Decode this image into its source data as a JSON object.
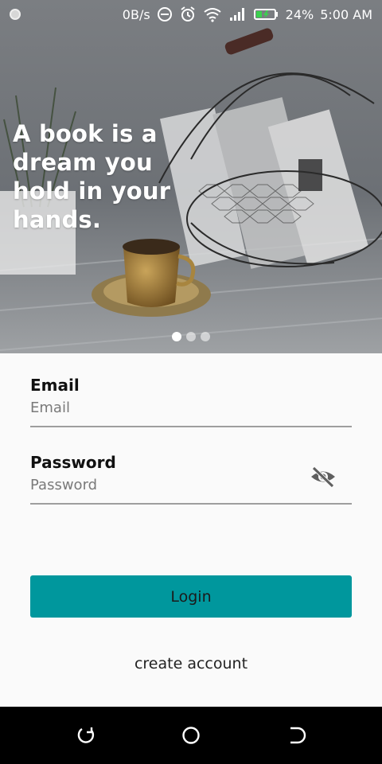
{
  "status_bar": {
    "net_speed": "0B/s",
    "battery": "24%",
    "time": "5:00 AM"
  },
  "hero": {
    "quote": "A book is a dream you hold in your hands.",
    "carousel": {
      "total": 3,
      "active_index": 0
    }
  },
  "form": {
    "email": {
      "label": "Email",
      "placeholder": "Email",
      "value": ""
    },
    "password": {
      "label": "Password",
      "placeholder": "Password",
      "value": ""
    }
  },
  "actions": {
    "login_label": "Login",
    "create_account_label": "create account"
  },
  "colors": {
    "accent": "#00979d",
    "background": "#fafafa",
    "navbar": "#000000"
  },
  "icons": {
    "password_toggle": "eye-off-icon",
    "nav": [
      "back-icon",
      "home-icon",
      "recents-icon"
    ]
  }
}
